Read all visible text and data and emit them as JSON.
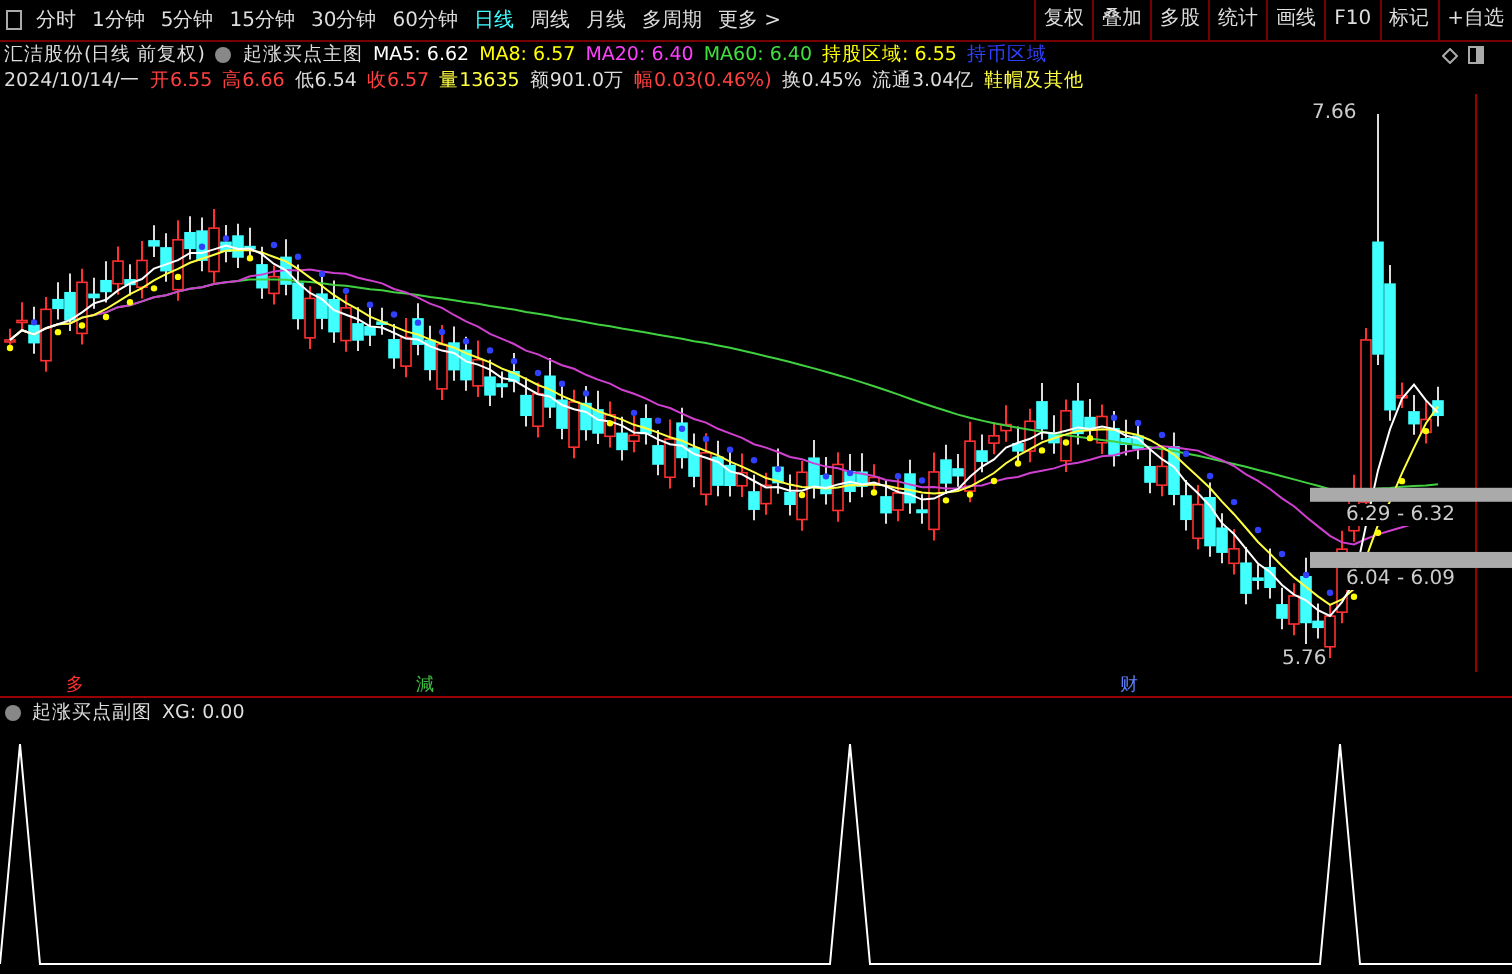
{
  "toolbar": {
    "tabs": [
      {
        "label": "分时",
        "selected": false
      },
      {
        "label": "1分钟",
        "selected": false
      },
      {
        "label": "5分钟",
        "selected": false
      },
      {
        "label": "15分钟",
        "selected": false
      },
      {
        "label": "30分钟",
        "selected": false
      },
      {
        "label": "60分钟",
        "selected": false
      },
      {
        "label": "日线",
        "selected": true
      },
      {
        "label": "周线",
        "selected": false
      },
      {
        "label": "月线",
        "selected": false
      },
      {
        "label": "多周期",
        "selected": false
      },
      {
        "label": "更多 >",
        "selected": false
      }
    ],
    "buttons": [
      "复权",
      "叠加",
      "多股",
      "统计",
      "画线",
      "F10",
      "标记",
      "+自选"
    ]
  },
  "main_header": {
    "stock": "汇洁股份(日线 前复权)",
    "indicator": "起涨买点主图",
    "values": [
      {
        "label": "MA5: 6.62",
        "color": "#ffffff"
      },
      {
        "label": "MA8: 6.57",
        "color": "#ffff00"
      },
      {
        "label": "MA20: 6.40",
        "color": "#ff40ff"
      },
      {
        "label": "MA60: 6.40",
        "color": "#40e040"
      },
      {
        "label": "持股区域: 6.55",
        "color": "#ffff00"
      },
      {
        "label": "持币区域",
        "color": "#3040ff"
      }
    ]
  },
  "quote": {
    "date": "2024/10/14/一",
    "fields": [
      {
        "text": "开6.55",
        "color": "#ff4040"
      },
      {
        "text": "高6.66",
        "color": "#ff4040"
      },
      {
        "text": "低6.54",
        "color": "#dddddd"
      },
      {
        "text": "收6.57",
        "color": "#ff4040"
      },
      {
        "text": "量13635",
        "color": "#ffff40"
      },
      {
        "text": "额901.0万",
        "color": "#dddddd"
      },
      {
        "text": "幅0.03(0.46%)",
        "color": "#ff4040"
      },
      {
        "text": "换0.45%",
        "color": "#dddddd"
      },
      {
        "text": "流通3.04亿",
        "color": "#dddddd"
      },
      {
        "text": "鞋帽及其他",
        "color": "#ffff40"
      }
    ]
  },
  "chart_labels": {
    "high": "7.66",
    "low": "5.76",
    "zones": [
      "6.29 - 6.32",
      "6.04 - 6.09"
    ]
  },
  "markers": [
    {
      "text": "多",
      "color": "#ff3030"
    },
    {
      "text": "減",
      "color": "#40c040"
    },
    {
      "text": "财",
      "color": "#6080ff"
    }
  ],
  "sub_header": {
    "indicator": "起涨买点副图",
    "value": "XG: 0.00"
  }
}
